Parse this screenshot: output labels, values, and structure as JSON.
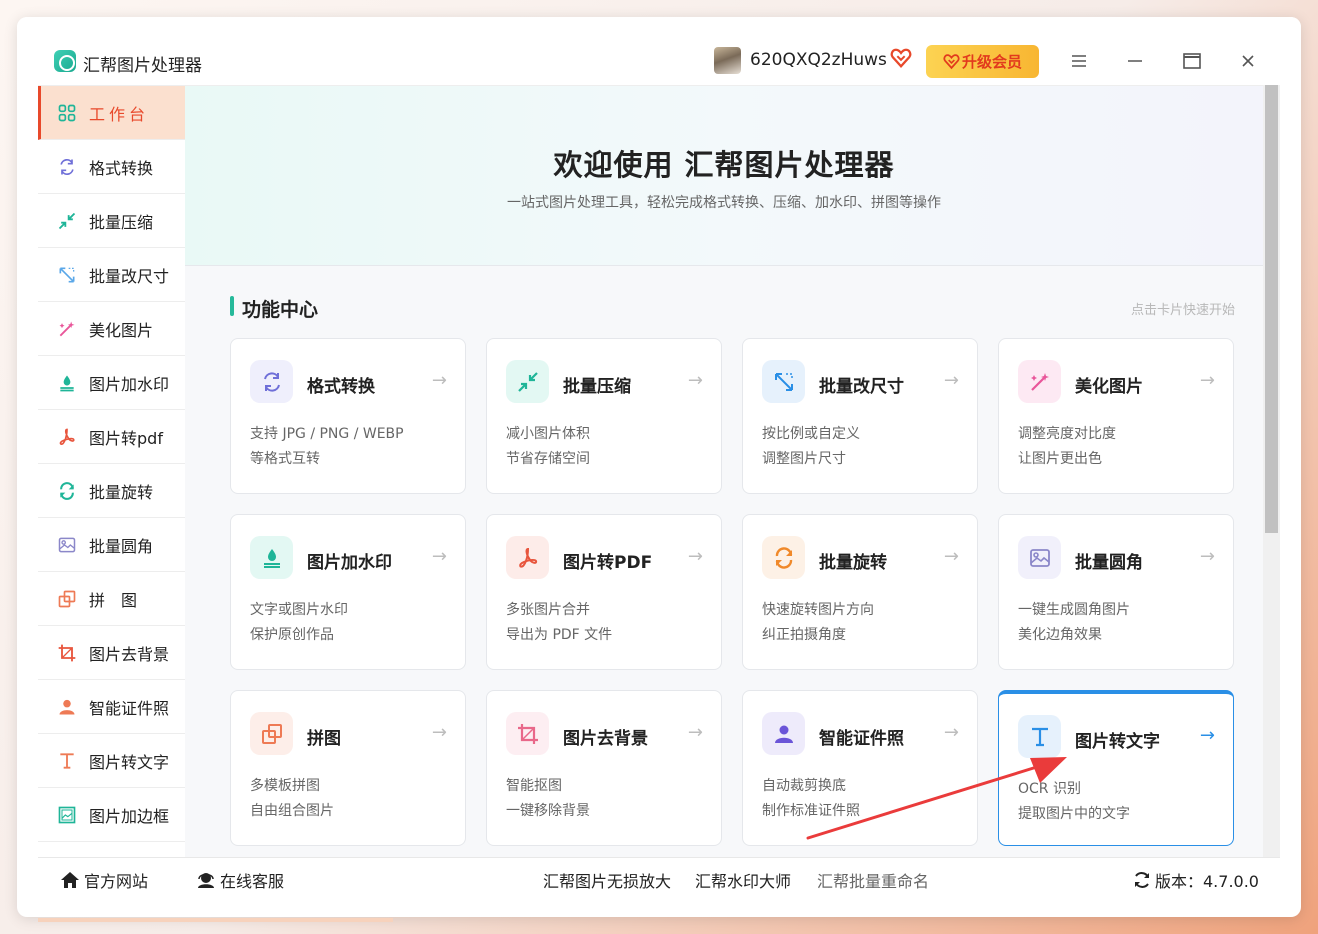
{
  "app": {
    "title": "汇帮图片处理器"
  },
  "header": {
    "username": "620QXQ2zHuws",
    "upgrade_label": "升级会员",
    "accent_color": "#e8492b"
  },
  "sidebar": {
    "items": [
      {
        "label": "工作台",
        "icon": "grid-icon",
        "active": true
      },
      {
        "label": "格式转换",
        "icon": "convert-icon"
      },
      {
        "label": "批量压缩",
        "icon": "compress-icon"
      },
      {
        "label": "批量改尺寸",
        "icon": "resize-icon"
      },
      {
        "label": "美化图片",
        "icon": "magic-wand-icon"
      },
      {
        "label": "图片加水印",
        "icon": "watermark-icon"
      },
      {
        "label": "图片转pdf",
        "icon": "pdf-icon"
      },
      {
        "label": "批量旋转",
        "icon": "rotate-icon"
      },
      {
        "label": "批量圆角",
        "icon": "image-icon"
      },
      {
        "label": "拼　图",
        "icon": "puzzle-icon"
      },
      {
        "label": "图片去背景",
        "icon": "crop-icon"
      },
      {
        "label": "智能证件照",
        "icon": "person-icon"
      },
      {
        "label": "图片转文字",
        "icon": "text-icon"
      },
      {
        "label": "图片加边框",
        "icon": "frame-icon"
      }
    ]
  },
  "hero": {
    "title": "欢迎使用 汇帮图片处理器",
    "subtitle": "一站式图片处理工具，轻松完成格式转换、压缩、加水印、拼图等操作"
  },
  "section": {
    "title": "功能中心",
    "hint": "点击卡片快速开始"
  },
  "cards": [
    {
      "title": "格式转换",
      "desc1": "支持 JPG / PNG / WEBP",
      "desc2": "等格式互转",
      "icon": "convert-icon",
      "bg": "#efeffc",
      "fg": "#6f6fd8"
    },
    {
      "title": "批量压缩",
      "desc1": "减小图片体积",
      "desc2": "节省存储空间",
      "icon": "compress-icon",
      "bg": "#e3f8f3",
      "fg": "#1fb598"
    },
    {
      "title": "批量改尺寸",
      "desc1": "按比例或自定义",
      "desc2": "调整图片尺寸",
      "icon": "resize-icon",
      "bg": "#e6f1fc",
      "fg": "#2a8fe6"
    },
    {
      "title": "美化图片",
      "desc1": "调整亮度对比度",
      "desc2": "让图片更出色",
      "icon": "magic-wand-icon",
      "bg": "#fde9f3",
      "fg": "#e9569a"
    },
    {
      "title": "图片加水印",
      "desc1": "文字或图片水印",
      "desc2": "保护原创作品",
      "icon": "watermark-icon",
      "bg": "#e3f8f3",
      "fg": "#1fb598"
    },
    {
      "title": "图片转PDF",
      "desc1": "多张图片合并",
      "desc2": "导出为 PDF 文件",
      "icon": "pdf-icon",
      "bg": "#fdece9",
      "fg": "#e8553d"
    },
    {
      "title": "批量旋转",
      "desc1": "快速旋转图片方向",
      "desc2": "纠正拍摄角度",
      "icon": "rotate-icon",
      "bg": "#fdf1e6",
      "fg": "#f0892a"
    },
    {
      "title": "批量圆角",
      "desc1": "一键生成圆角图片",
      "desc2": "美化边角效果",
      "icon": "image-icon",
      "bg": "#f1f0fb",
      "fg": "#8b87c9"
    },
    {
      "title": "拼图",
      "desc1": "多模板拼图",
      "desc2": "自由组合图片",
      "icon": "puzzle-icon",
      "bg": "#fdeee9",
      "fg": "#ee7a55"
    },
    {
      "title": "图片去背景",
      "desc1": "智能抠图",
      "desc2": "一键移除背景",
      "icon": "crop-icon",
      "bg": "#fdeef2",
      "fg": "#e9688a"
    },
    {
      "title": "智能证件照",
      "desc1": "自动裁剪换底",
      "desc2": "制作标准证件照",
      "icon": "person-icon",
      "bg": "#eeebfb",
      "fg": "#6b55d8"
    },
    {
      "title": "图片转文字",
      "desc1": "OCR 识别",
      "desc2": "提取图片中的文字",
      "icon": "text-icon",
      "bg": "#e6f1fc",
      "fg": "#2a8fe6",
      "highlight": true
    }
  ],
  "footer": {
    "official_site": "官方网站",
    "support": "在线客服",
    "links": [
      "汇帮图片无损放大",
      "汇帮水印大师",
      "汇帮批量重命名"
    ],
    "version": "版本：4.7.0.0"
  }
}
